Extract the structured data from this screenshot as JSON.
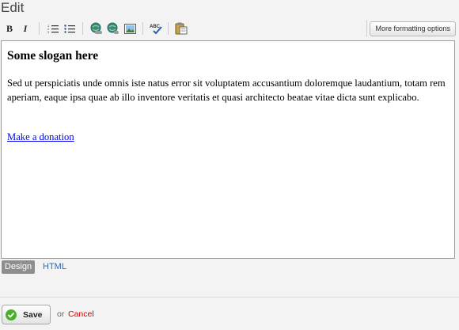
{
  "header": {
    "title": "Edit"
  },
  "toolbar": {
    "more_options_label": "More formatting options",
    "buttons": [
      {
        "name": "bold",
        "glyph": "B"
      },
      {
        "name": "italic",
        "glyph": "I"
      }
    ]
  },
  "editor": {
    "heading": "Some slogan here",
    "body": "Sed ut perspiciatis unde omnis iste natus error sit voluptatem accusantium doloremque laudantium, totam rem aperiam, eaque ipsa quae ab illo inventore veritatis et quasi architecto beatae vitae dicta sunt explicabo.",
    "link_text": "Make a donation"
  },
  "modes": {
    "design_label": "Design",
    "html_label": "HTML"
  },
  "footer": {
    "save_label": "Save",
    "or_label": "or",
    "cancel_label": "Cancel"
  },
  "colors": {
    "link": "#0000ee",
    "cancel": "#dd0000",
    "mode_html": "#2d6bb3",
    "save_icon": "#4caf2a"
  }
}
